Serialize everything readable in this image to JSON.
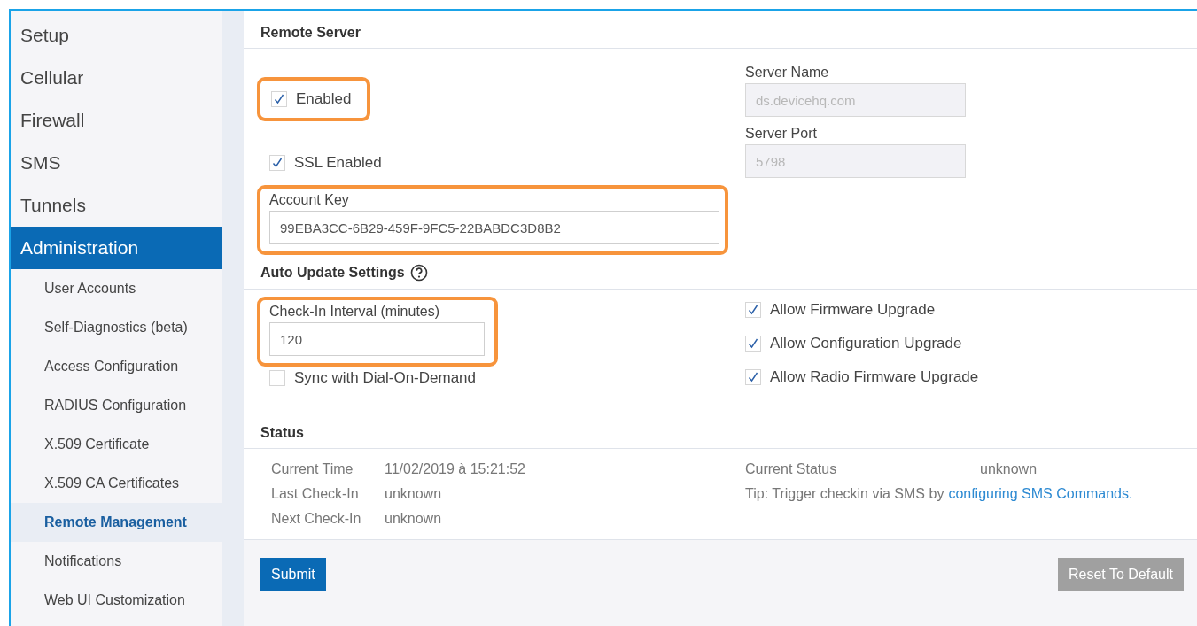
{
  "sidebar": {
    "items": [
      {
        "label": "Setup",
        "selected": false
      },
      {
        "label": "Cellular",
        "selected": false
      },
      {
        "label": "Firewall",
        "selected": false
      },
      {
        "label": "SMS",
        "selected": false
      },
      {
        "label": "Tunnels",
        "selected": false
      },
      {
        "label": "Administration",
        "selected": true,
        "children": [
          {
            "label": "User Accounts",
            "selected": false
          },
          {
            "label": "Self-Diagnostics (beta)",
            "selected": false
          },
          {
            "label": "Access Configuration",
            "selected": false
          },
          {
            "label": "RADIUS Configuration",
            "selected": false
          },
          {
            "label": "X.509 Certificate",
            "selected": false
          },
          {
            "label": "X.509 CA Certificates",
            "selected": false
          },
          {
            "label": "Remote Management",
            "selected": true
          },
          {
            "label": "Notifications",
            "selected": false
          },
          {
            "label": "Web UI Customization",
            "selected": false
          }
        ]
      }
    ]
  },
  "remote_server": {
    "title": "Remote Server",
    "enabled": {
      "label": "Enabled",
      "checked": true,
      "highlighted": true
    },
    "ssl_enabled": {
      "label": "SSL Enabled",
      "checked": true
    },
    "account_key": {
      "label": "Account Key",
      "value": "99EBA3CC-6B29-459F-9FC5-22BABDC3D8B2",
      "highlighted": true
    },
    "server_name": {
      "label": "Server Name",
      "placeholder": "ds.devicehq.com",
      "disabled": true
    },
    "server_port": {
      "label": "Server Port",
      "placeholder": "5798",
      "disabled": true
    }
  },
  "auto_update": {
    "title": "Auto Update Settings",
    "check_in_interval": {
      "label": "Check-In Interval (minutes)",
      "value": "120",
      "highlighted": true
    },
    "sync_dial_on_demand": {
      "label": "Sync with Dial-On-Demand",
      "checked": false
    },
    "options": [
      {
        "label": "Allow Firmware Upgrade",
        "checked": true
      },
      {
        "label": "Allow Configuration Upgrade",
        "checked": true
      },
      {
        "label": "Allow Radio Firmware Upgrade",
        "checked": true
      }
    ]
  },
  "status": {
    "title": "Status",
    "rows": [
      {
        "label": "Current Time",
        "value": "11/02/2019 à 15:21:52"
      },
      {
        "label": "Last Check-In",
        "value": "unknown"
      },
      {
        "label": "Next Check-In",
        "value": "unknown"
      }
    ],
    "current_status": {
      "label": "Current Status",
      "value": "unknown"
    },
    "tip": {
      "text": "Tip: Trigger checkin via SMS by",
      "link": "configuring SMS Commands."
    }
  },
  "buttons": {
    "submit": "Submit",
    "reset": "Reset To Default"
  }
}
